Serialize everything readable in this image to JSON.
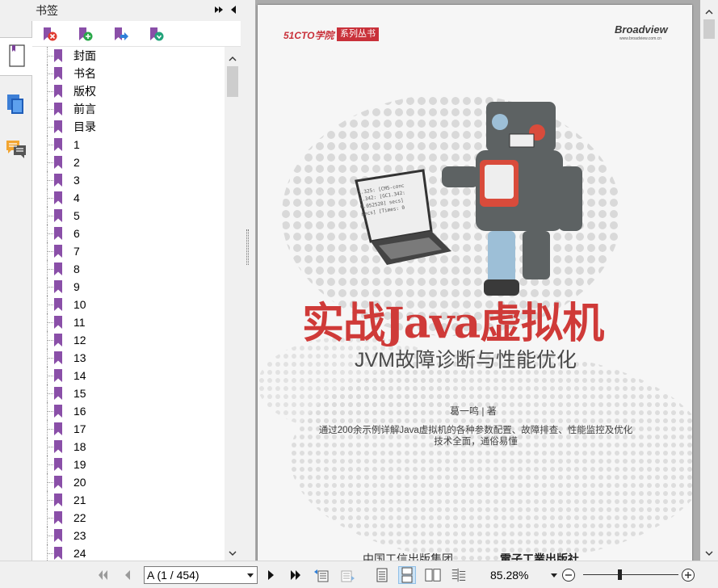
{
  "bookmarks_panel": {
    "title": "书签",
    "tree": [
      {
        "label": "封面"
      },
      {
        "label": "书名"
      },
      {
        "label": "版权"
      },
      {
        "label": "前言"
      },
      {
        "label": "目录"
      },
      {
        "label": "1"
      },
      {
        "label": "2"
      },
      {
        "label": "3"
      },
      {
        "label": "4"
      },
      {
        "label": "5"
      },
      {
        "label": "6"
      },
      {
        "label": "7"
      },
      {
        "label": "8"
      },
      {
        "label": "9"
      },
      {
        "label": "10"
      },
      {
        "label": "11"
      },
      {
        "label": "12"
      },
      {
        "label": "13"
      },
      {
        "label": "14"
      },
      {
        "label": "15"
      },
      {
        "label": "16"
      },
      {
        "label": "17"
      },
      {
        "label": "18"
      },
      {
        "label": "19"
      },
      {
        "label": "20"
      },
      {
        "label": "21"
      },
      {
        "label": "22"
      },
      {
        "label": "23"
      },
      {
        "label": "24"
      }
    ],
    "toolbar_icons": [
      "delete-bookmark-icon",
      "add-bookmark-icon",
      "goto-bookmark-icon",
      "expand-bookmark-icon"
    ],
    "accent_color": "#8a4fa8"
  },
  "sidebar_tabs": [
    "page-thumbnail-icon",
    "pages-icon",
    "comments-icon"
  ],
  "cover": {
    "series_brand": "51CTO学院",
    "series_tag": "系列丛书",
    "publisher_brand": "Broadview",
    "publisher_url": "www.broadview.com.cn",
    "title": "实战Java虚拟机",
    "subtitle": "JVM故障诊断与性能优化",
    "author": "葛一鸣 | 著",
    "blurb_line1": "通过200余示例详解Java虚拟机的各种参数配置、故障排查、性能监控及优化",
    "blurb_line2": "技术全面，通俗易懂",
    "footer_publisher1": "中国工信出版集团",
    "footer_publisher2": "電子工業出版社",
    "screen_code_lines": [
      "1.325: [CMS-conc",
      "1.342: [GC1.342:",
      "0.052528] secs]",
      "secs] [Times: 0"
    ],
    "title_color": "#cf3a38"
  },
  "statusbar": {
    "page_indicator": "A (1 / 454)",
    "zoom": "85.28%",
    "zoom_level_fraction": 0.38
  }
}
